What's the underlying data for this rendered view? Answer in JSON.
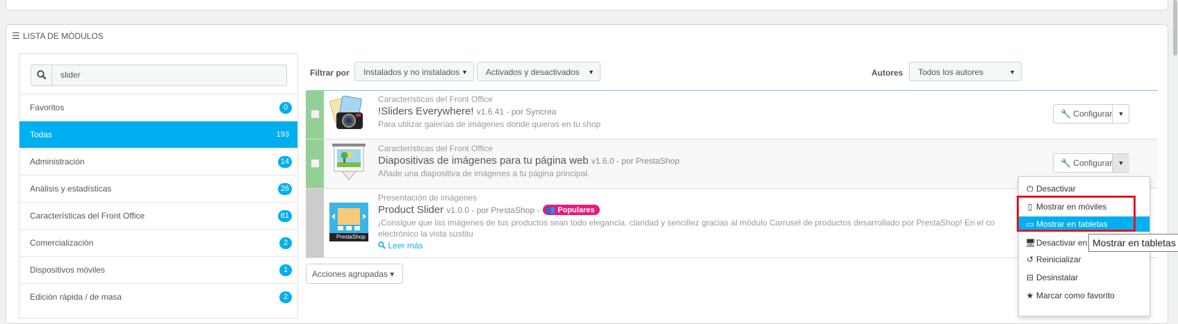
{
  "panel": {
    "title": "LISTA DE MÓDULOS"
  },
  "search": {
    "value": "slider"
  },
  "categories": [
    {
      "label": "Favoritos",
      "count": "0"
    },
    {
      "label": "Todas",
      "count": "193"
    },
    {
      "label": "Administración",
      "count": "14"
    },
    {
      "label": "Análisis y estadísticas",
      "count": "26"
    },
    {
      "label": "Características del Front Office",
      "count": "61"
    },
    {
      "label": "Comercialización",
      "count": "2"
    },
    {
      "label": "Dispositivos móviles",
      "count": "1"
    },
    {
      "label": "Edición rápida / de masa",
      "count": "2"
    }
  ],
  "filters": {
    "filter_label": "Filtrar por",
    "install_select": "Instalados y no instalados",
    "status_select": "Activados y desactivados",
    "authors_label": "Autores",
    "authors_select": "Todos los autores"
  },
  "modules": [
    {
      "category": "Características del Front Office",
      "name": "!Sliders Everywhere!",
      "version": "v1.6.41 - por Syncrea",
      "description": "Para utilizar galerías de imágenes donde quieras en tu shop",
      "button": "Configurar"
    },
    {
      "category": "Características del Front Office",
      "name": "Diapositivas de imágenes para tu página web",
      "version": "v1.6.0 - por PrestaShop",
      "description": "Añade una diapositiva de imágenes a tu página principal.",
      "button": "Configurar"
    },
    {
      "category": "Presentación de imágenes",
      "name": "Product Slider",
      "version": "v1.0.0 - por PrestaShop -",
      "badge": "Populares",
      "description": "¡Consigue que las imágenes de tus productos sean todo elegancia, claridad y sencillez gracias al módulo Carrusel de productos desarrollado por PrestaShop! En el co",
      "description2": "electrónico la vista sustitu",
      "read_more": "Leer más",
      "logo_text": "PrestaShop"
    }
  ],
  "bulk_actions": "Acciones agrupadas",
  "dropdown": [
    {
      "label": "Desactivar",
      "icon": "power-icon"
    },
    {
      "label": "Mostrar en móviles",
      "icon": "mobile-icon"
    },
    {
      "label": "Mostrar en tabletas",
      "icon": "tablet-icon"
    },
    {
      "label": "Desactivar en",
      "icon": "desktop-icon"
    },
    {
      "label": "Reinicializar",
      "icon": "undo-icon"
    },
    {
      "label": "Desinstalar",
      "icon": "minus-square-icon"
    },
    {
      "label": "Marcar como favorito",
      "icon": "star-icon"
    }
  ],
  "tooltip": "Mostrar en tabletas",
  "colors": {
    "accent": "#00aff0",
    "enabled": "#93d095",
    "popular": "#e71b7c",
    "highlight": "#e5131f"
  }
}
